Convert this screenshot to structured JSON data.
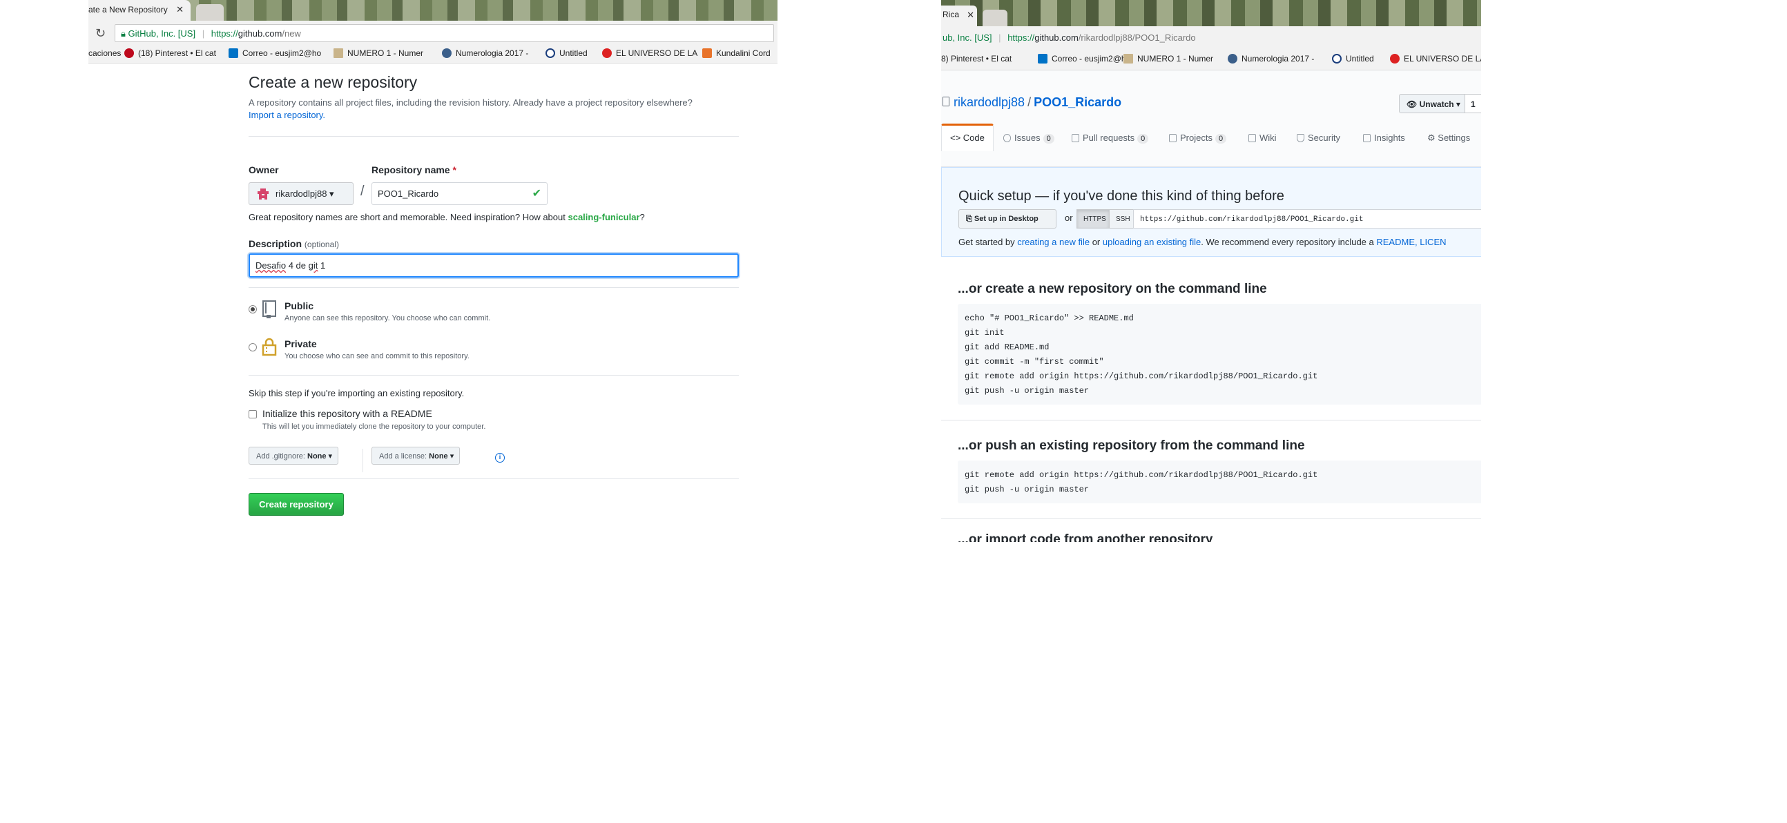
{
  "left": {
    "tab": {
      "title": "ate a New Repository",
      "close": "✕"
    },
    "address": {
      "secure_label": "GitHub, Inc. [US]",
      "url_scheme": "https://",
      "url_host": "github.com",
      "url_path": "/new"
    },
    "bookmarks": [
      {
        "label": "caciones",
        "color": "#f2f2f2"
      },
      {
        "label": "(18) Pinterest • El cat",
        "color": "#bd081c"
      },
      {
        "label": "Correo - eusjim2@ho",
        "color": "#0072c6"
      },
      {
        "label": "NUMERO 1 - Numer",
        "color": "#c9b48a"
      },
      {
        "label": "Numerologia 2017 -",
        "color": "#3b5f8a"
      },
      {
        "label": "Untitled",
        "color": "#1a3d7c"
      },
      {
        "label": "EL UNIVERSO DE LA",
        "color": "#d22"
      },
      {
        "label": "Kundalini Cord",
        "color": "#e8732a"
      }
    ],
    "page": {
      "title": "Create a new repository",
      "subtitle": "A repository contains all project files, including the revision history. Already have a project repository elsewhere?",
      "import_link": "Import a repository.",
      "owner_label": "Owner",
      "owner_value": "rikardodlpj88 ▾",
      "slash": "/",
      "repo_label": "Repository name",
      "required_mark": "*",
      "repo_value": "POO1_Ricardo",
      "hint_prefix": "Great repository names are short and memorable. Need inspiration? How about",
      "hint_suggestion": "scaling-funicular",
      "hint_suffix": "?",
      "desc_label": "Description",
      "desc_optional": "(optional)",
      "desc_word1": "Desafio",
      "desc_mid": " 4 de ",
      "desc_word2": "git",
      "desc_end": " 1",
      "public_title": "Public",
      "public_note": "Anyone can see this repository. You choose who can commit.",
      "private_title": "Private",
      "private_note": "You choose who can see and commit to this repository.",
      "skip_text": "Skip this step if you're importing an existing repository.",
      "init_label": "Initialize this repository with a README",
      "init_note": "This will let you immediately clone the repository to your computer.",
      "gitignore_label": "Add .gitignore:",
      "gitignore_value": "None ▾",
      "license_label": "Add a license:",
      "license_value": "None ▾",
      "info": "i",
      "create_button": "Create repository"
    }
  },
  "right": {
    "tab": {
      "title": "Rica",
      "close": "✕"
    },
    "address": {
      "secure_label": "ub, Inc. [US]",
      "url_scheme": "https://",
      "url_host": "github.com",
      "url_path": "/rikardodlpj88/POO1_Ricardo"
    },
    "bookmarks": [
      {
        "label": "8) Pinterest • El cat",
        "color": "#bd081c"
      },
      {
        "label": "Correo - eusjim2@ho",
        "color": "#0072c6"
      },
      {
        "label": "NUMERO 1 - Numer",
        "color": "#c9b48a"
      },
      {
        "label": "Numerologia 2017 -",
        "color": "#3b5f8a"
      },
      {
        "label": "Untitled",
        "color": "#1a3d7c"
      },
      {
        "label": "EL UNIVERSO DE LA",
        "color": "#d22"
      }
    ],
    "repo": {
      "owner": "rikardodlpj88",
      "sep": "/",
      "name": "POO1_Ricardo",
      "unwatch": "Unwatch ▾",
      "watch_count": "1"
    },
    "tabs": [
      {
        "label": "<> Code"
      },
      {
        "label": "Issues",
        "count": "0"
      },
      {
        "label": "Pull requests",
        "count": "0"
      },
      {
        "label": "Projects",
        "count": "0"
      },
      {
        "label": "Wiki"
      },
      {
        "label": "Security"
      },
      {
        "label": "Insights"
      },
      {
        "label": "Settings"
      }
    ],
    "quick": {
      "title": "Quick setup — if you've done this kind of thing before",
      "desktop_button": "Set up in Desktop",
      "or": "or",
      "https": "HTTPS",
      "ssh": "SSH",
      "clone_url": "https://github.com/rikardodlpj88/POO1_Ricardo.git",
      "gs_prefix": "Get started by",
      "gs_link1": "creating a new file",
      "gs_or": "or",
      "gs_link2": "uploading an existing file",
      "gs_mid": ". We recommend every repository include a",
      "gs_link3": "README, LICEN"
    },
    "cmdline": {
      "title": "...or create a new repository on the command line",
      "code": "echo \"# POO1_Ricardo\" >> README.md\ngit init\ngit add README.md\ngit commit -m \"first commit\"\ngit remote add origin https://github.com/rikardodlpj88/POO1_Ricardo.git\ngit push -u origin master"
    },
    "push": {
      "title": "...or push an existing repository from the command line",
      "code": "git remote add origin https://github.com/rikardodlpj88/POO1_Ricardo.git\ngit push -u origin master"
    },
    "peek_text": "...or import code from another repository"
  },
  "colors": {
    "link": "#0366d6",
    "success": "#28a745",
    "focus": "#2188ff",
    "tab_accent": "#e36209",
    "quick_bg": "#f1f8ff"
  }
}
